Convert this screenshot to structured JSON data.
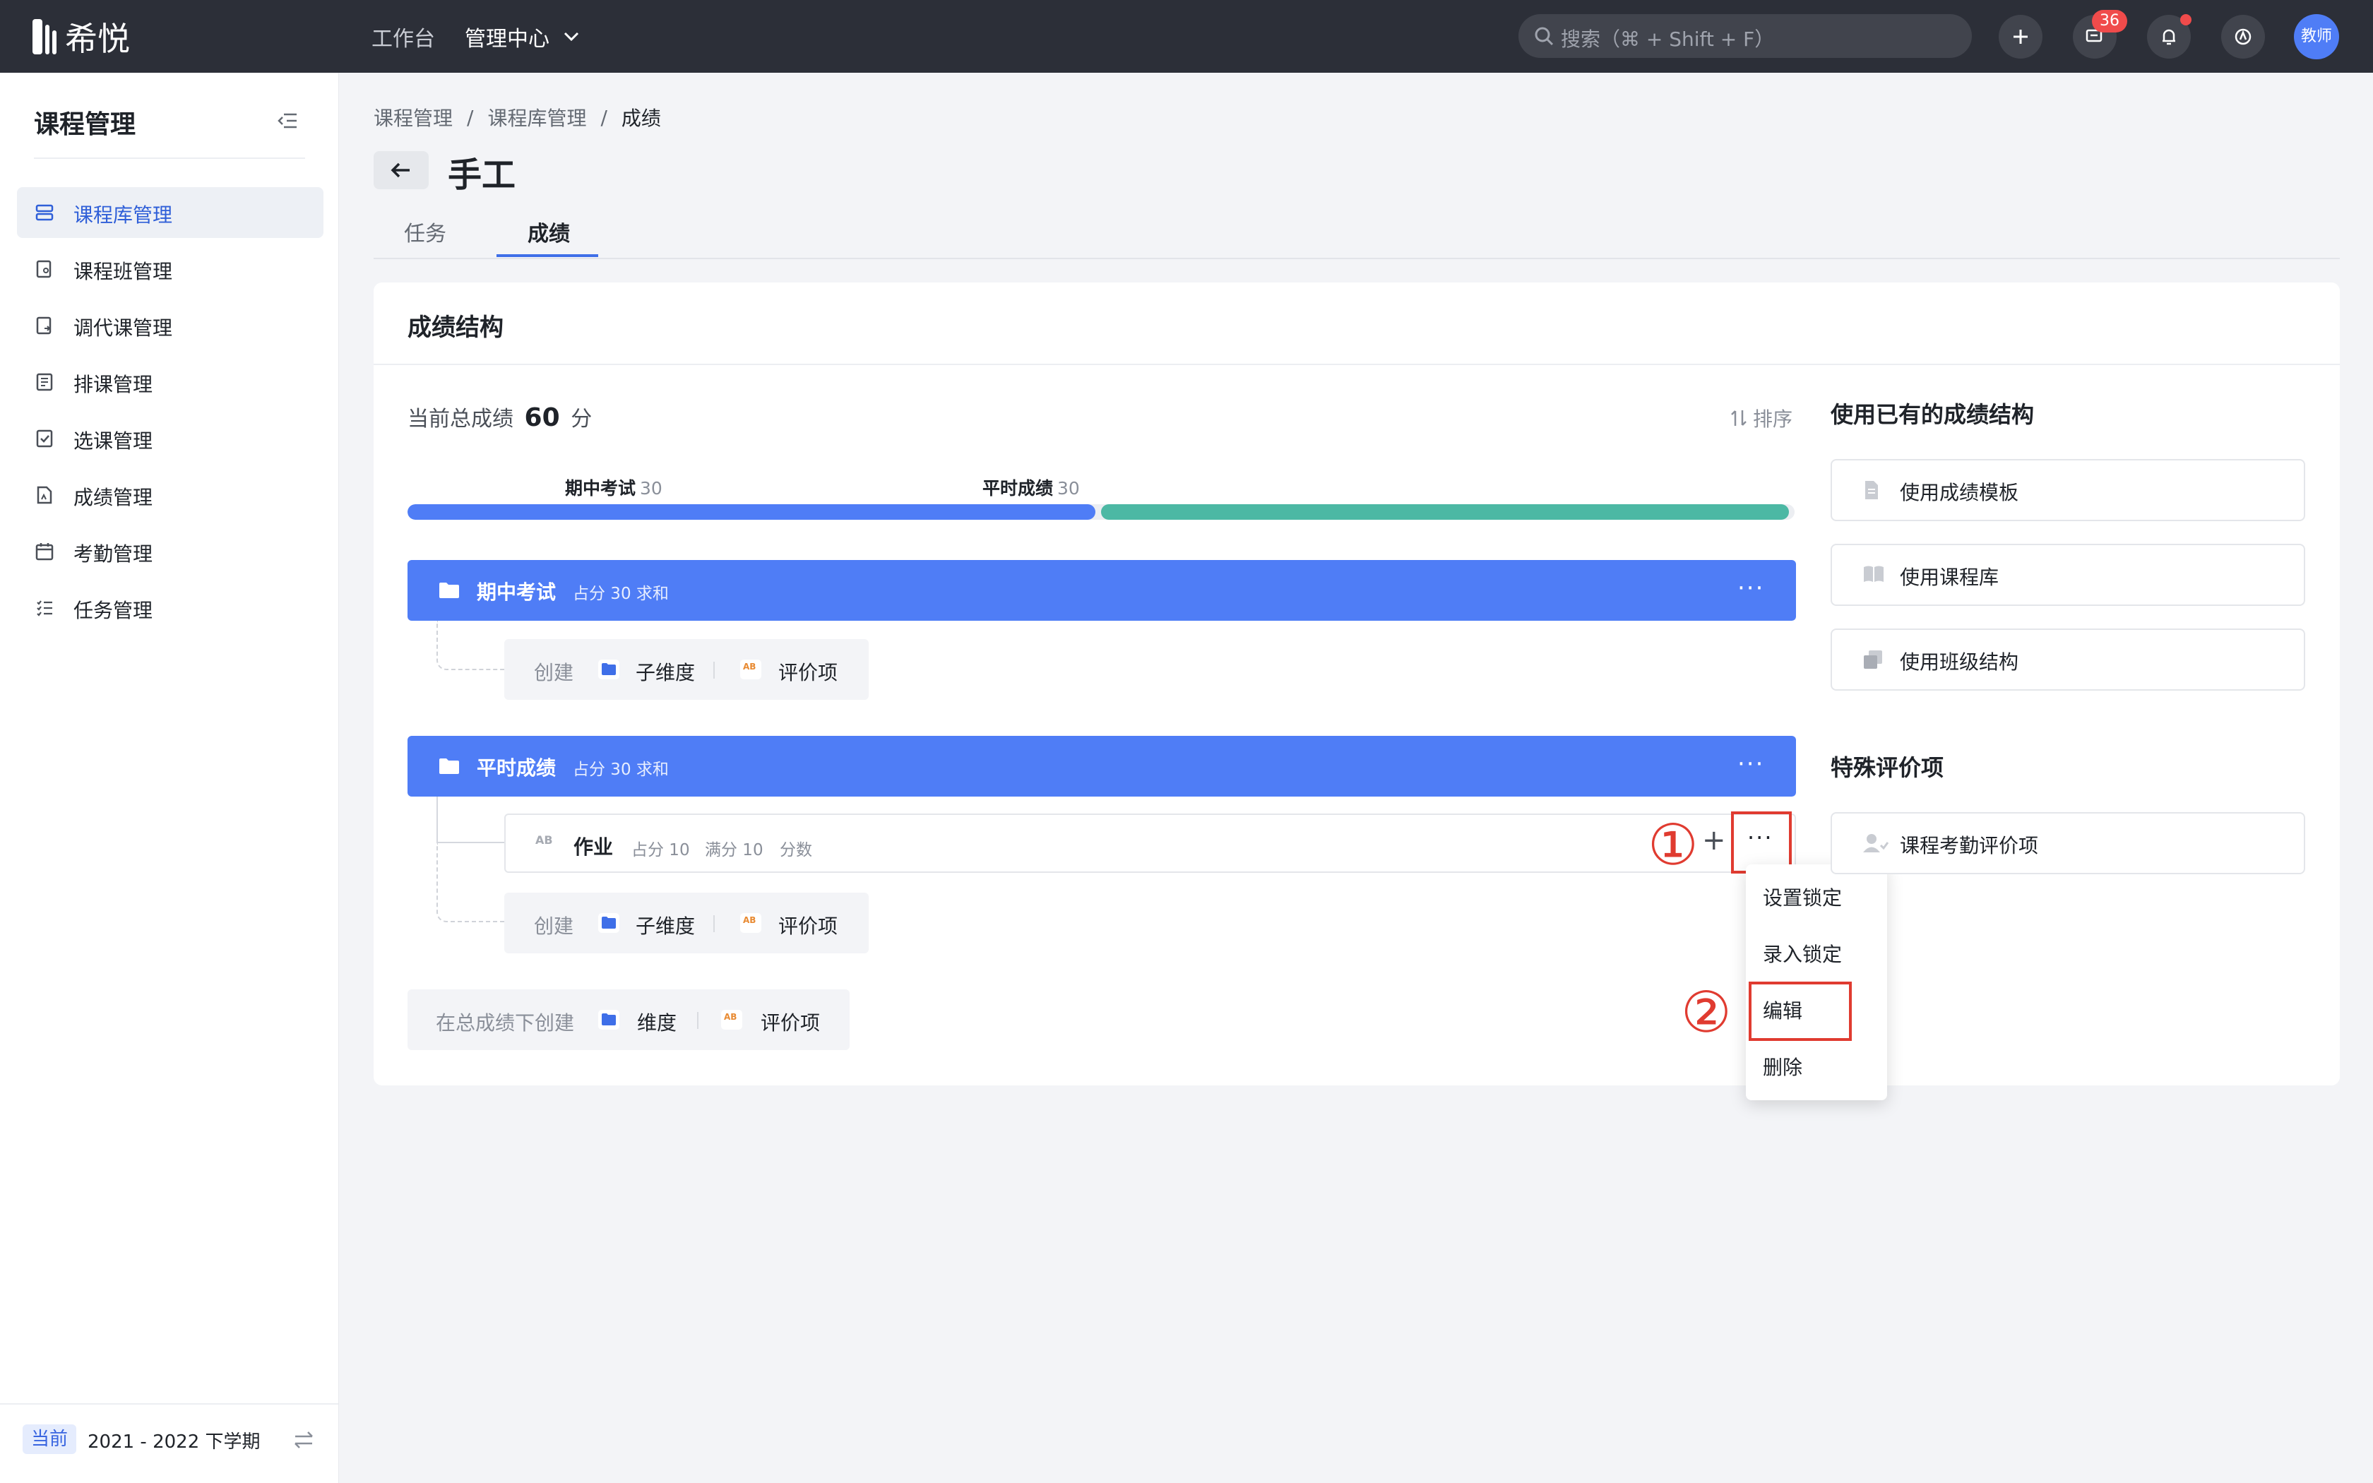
{
  "topbar": {
    "logo_text": "希悦",
    "nav": [
      "工作台",
      "管理中心"
    ],
    "search_placeholder": "搜索（⌘ + Shift + F）",
    "message_count": "36",
    "avatar_text": "教师"
  },
  "sidebar": {
    "title": "课程管理",
    "items": [
      {
        "label": "课程库管理",
        "icon": "layers-icon",
        "active": true
      },
      {
        "label": "课程班管理",
        "icon": "class-book-icon"
      },
      {
        "label": "调代课管理",
        "icon": "substitute-icon"
      },
      {
        "label": "排课管理",
        "icon": "schedule-icon"
      },
      {
        "label": "选课管理",
        "icon": "checklist-icon"
      },
      {
        "label": "成绩管理",
        "icon": "grade-file-icon"
      },
      {
        "label": "考勤管理",
        "icon": "calendar-icon"
      },
      {
        "label": "任务管理",
        "icon": "task-list-icon"
      }
    ],
    "footer": {
      "tag": "当前",
      "term": "2021 - 2022 下学期"
    }
  },
  "breadcrumb": [
    "课程管理",
    "课程库管理",
    "成绩"
  ],
  "page_title": "手工",
  "tabs": [
    {
      "label": "任务"
    },
    {
      "label": "成绩",
      "active": true
    }
  ],
  "card": {
    "title": "成绩结构",
    "total_prefix": "当前总成绩",
    "total_value": "60",
    "total_unit": "分",
    "sort_label": "排序",
    "progress": [
      {
        "label": "期中考试",
        "value": "30",
        "share": 0.5,
        "color": "#4f7df6"
      },
      {
        "label": "平时成绩",
        "value": "30",
        "share": 0.5,
        "color": "#4cb8a4"
      }
    ],
    "groups": [
      {
        "name": "期中考试",
        "meta": "占分 30 求和",
        "more": "···"
      },
      {
        "name": "平时成绩",
        "meta": "占分 30 求和",
        "more": "···"
      }
    ],
    "create": {
      "label": "创建",
      "sub_dimension": "子维度",
      "eval_item": "评价项"
    },
    "item": {
      "icon_text": "AB",
      "name": "作业",
      "share": "占分 10",
      "full": "满分 10",
      "type": "分数",
      "more": "···"
    },
    "root_create": {
      "label": "在总成绩下创建",
      "dimension": "维度",
      "eval_item": "评价项"
    }
  },
  "context_menu": [
    "设置锁定",
    "录入锁定",
    "编辑",
    "删除"
  ],
  "annotations": [
    "①",
    "②"
  ],
  "right_panel": {
    "title": "使用已有的成绩结构",
    "buttons": [
      "使用成绩模板",
      "使用课程库",
      "使用班级结构"
    ],
    "special_title": "特殊评价项",
    "special_button": "课程考勤评价项"
  }
}
